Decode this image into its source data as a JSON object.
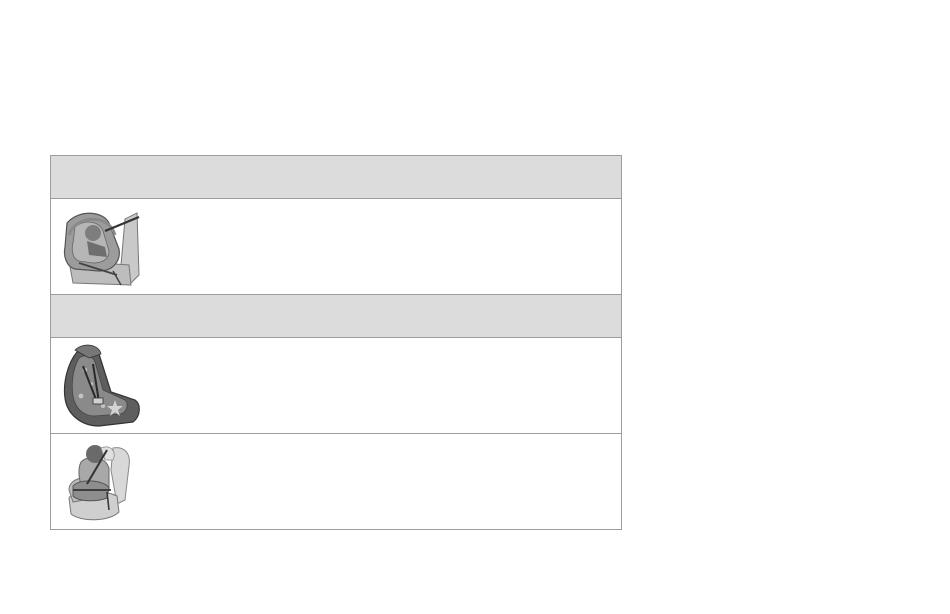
{
  "table": {
    "sections": [
      {
        "header": "",
        "rows": [
          {
            "icon": "rear-facing-infant-seat",
            "text": ""
          }
        ]
      },
      {
        "header": "",
        "rows": [
          {
            "icon": "forward-facing-harness-seat",
            "text": ""
          },
          {
            "icon": "booster-seat",
            "text": ""
          }
        ]
      }
    ]
  },
  "colors": {
    "header_band": "#dcdcdc",
    "border": "#9d9d9d",
    "background": "#ffffff"
  }
}
